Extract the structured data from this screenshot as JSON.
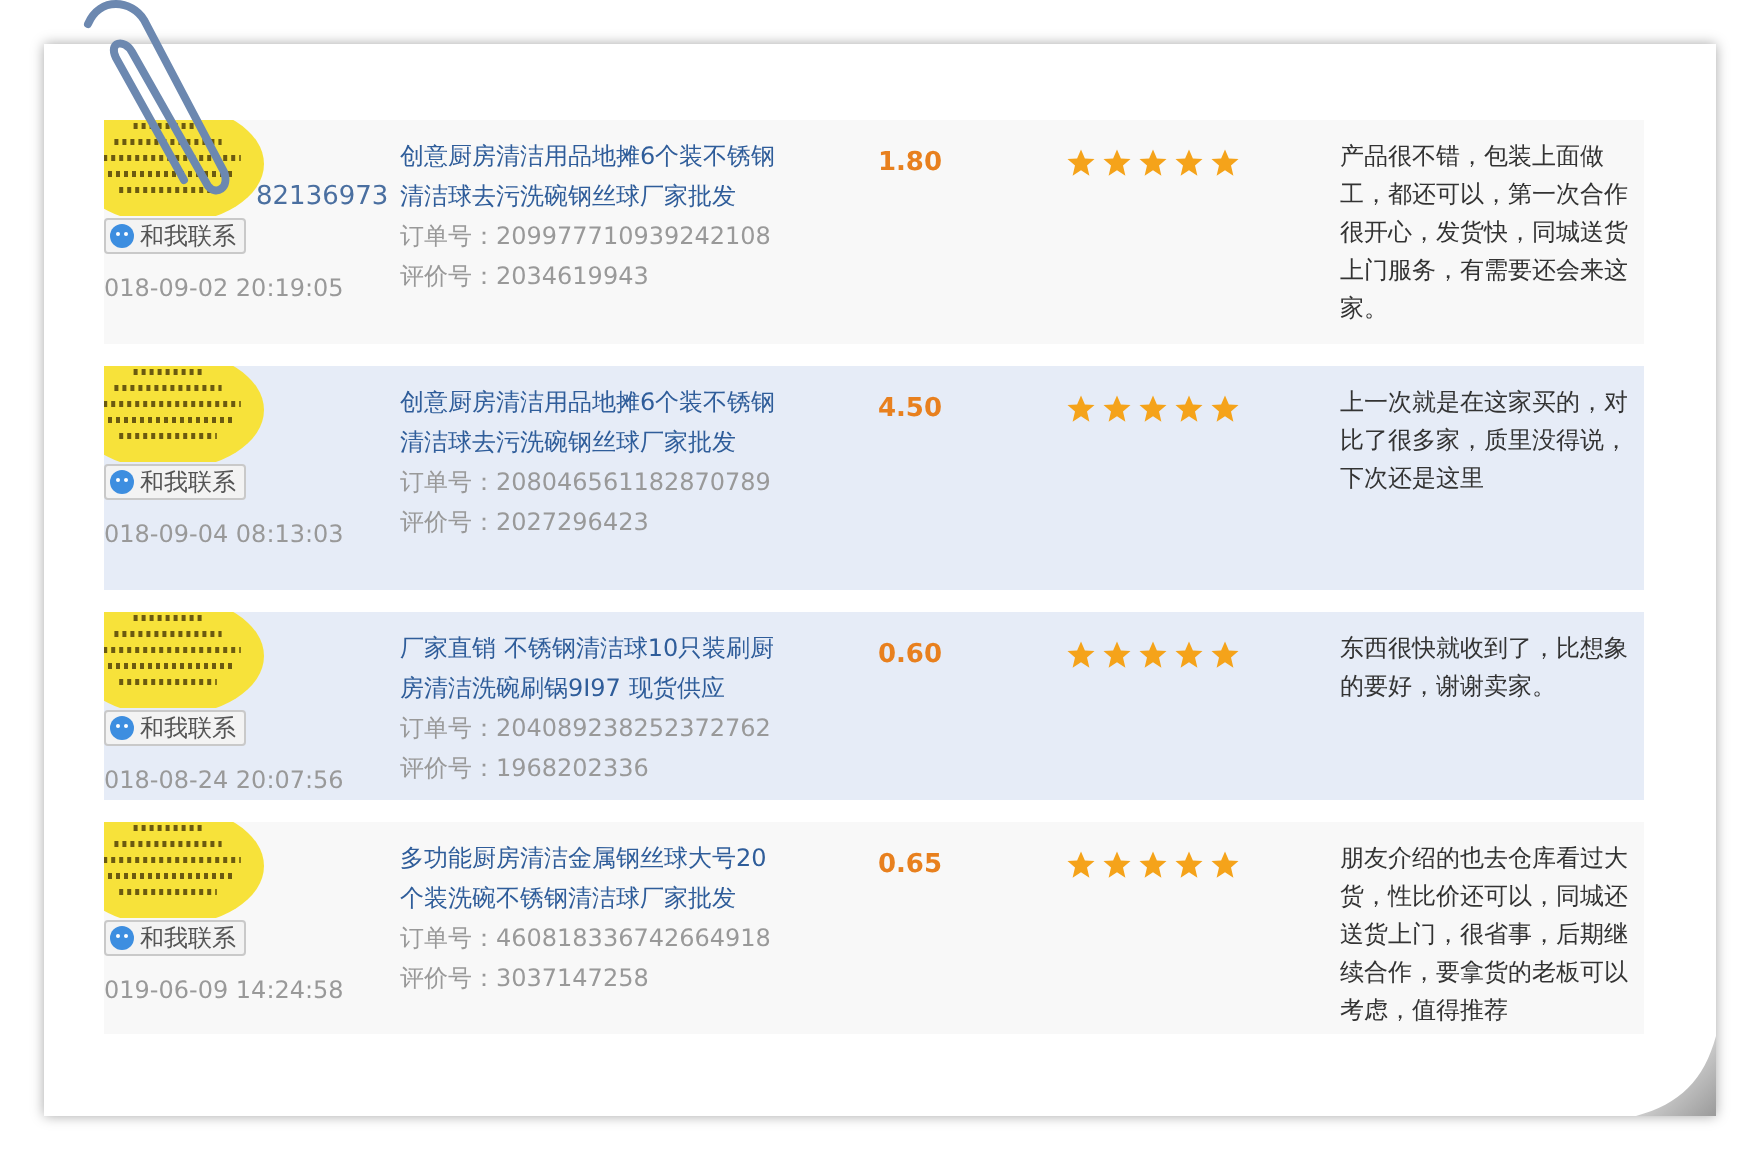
{
  "reviews": [
    {
      "highlighted": false,
      "buyer": "82136973",
      "contact_button": "和我联系",
      "date": "018-09-02 20:19:05",
      "title": "创意厨房清洁用品地摊6个装不锈钢清洁球去污洗碗钢丝球厂家批发",
      "order_no": "订单号：209977710939242108",
      "review_no": "评价号：2034619943",
      "price": "1.80",
      "stars": 5,
      "comment": "产品很不错，包装上面做工，都还可以，第一次合作很开心，发货快，同城送货上门服务，有需要还会来这家。"
    },
    {
      "highlighted": true,
      "contact_button": "和我联系",
      "date": "018-09-04 08:13:03",
      "title": "创意厨房清洁用品地摊6个装不锈钢清洁球去污洗碗钢丝球厂家批发",
      "order_no": "订单号：208046561182870789",
      "review_no": "评价号：2027296423",
      "price": "4.50",
      "stars": 5,
      "comment": "上一次就是在这家买的，对比了很多家，质里没得说，下次还是这里"
    },
    {
      "highlighted": true,
      "contact_button": "和我联系",
      "date": "018-08-24 20:07:56",
      "title": "厂家直销 不锈钢清洁球10只装刷厨房清洁洗碗刷锅9I97 现货供应",
      "order_no": "订单号：204089238252372762",
      "review_no": "评价号：1968202336",
      "price": "0.60",
      "stars": 5,
      "comment": "东西很快就收到了，比想象的要好，谢谢卖家。"
    },
    {
      "highlighted": false,
      "contact_button": "和我联系",
      "date": "019-06-09 14:24:58",
      "title": "多功能厨房清洁金属钢丝球大号20个装洗碗不锈钢清洁球厂家批发",
      "order_no": "订单号：460818336742664918",
      "review_no": "评价号：3037147258",
      "price": "0.65",
      "stars": 5,
      "comment": "朋友介绍的也去仓库看过大货，性比价还可以，同城还送货上门，很省事，后期继续合作，要拿货的老板可以考虑，值得推荐"
    }
  ]
}
